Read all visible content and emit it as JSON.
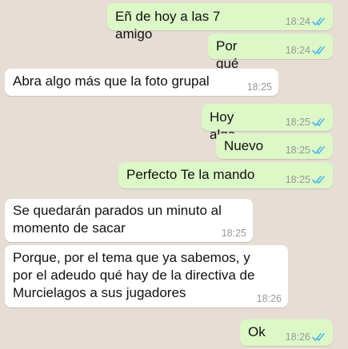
{
  "colors": {
    "chat_background": "#e6ddd4",
    "outgoing_bubble": "#dcf8c6",
    "incoming_bubble": "#ffffff",
    "read_ticks": "#4fb6ec",
    "timestamp": "#999999"
  },
  "messages": [
    {
      "direction": "outgoing",
      "text": "Eñ de hoy a las 7 amigo",
      "time": "18:24",
      "status": "read"
    },
    {
      "direction": "outgoing",
      "text": "Por qué",
      "time": "18:24",
      "status": "read"
    },
    {
      "direction": "incoming",
      "text": "Abra algo más que la foto grupal",
      "time": "18:25"
    },
    {
      "direction": "outgoing",
      "text": "Hoy algo",
      "time": "18:25",
      "status": "read"
    },
    {
      "direction": "outgoing",
      "text": "Nuevo",
      "time": "18:25",
      "status": "read"
    },
    {
      "direction": "outgoing",
      "text": "Perfecto Te la mando",
      "time": "18:25",
      "status": "read"
    },
    {
      "direction": "incoming",
      "text": "Se quedarán parados un minuto al\nmomento de sacar",
      "time": "18:25"
    },
    {
      "direction": "incoming",
      "text": "Porque, por el tema que ya sabemos, y\npor el adeudo qué hay de la directiva de\nMurcielagos a sus jugadores",
      "time": "18:26"
    },
    {
      "direction": "outgoing",
      "text": "Ok",
      "time": "18:26",
      "status": "read"
    }
  ]
}
